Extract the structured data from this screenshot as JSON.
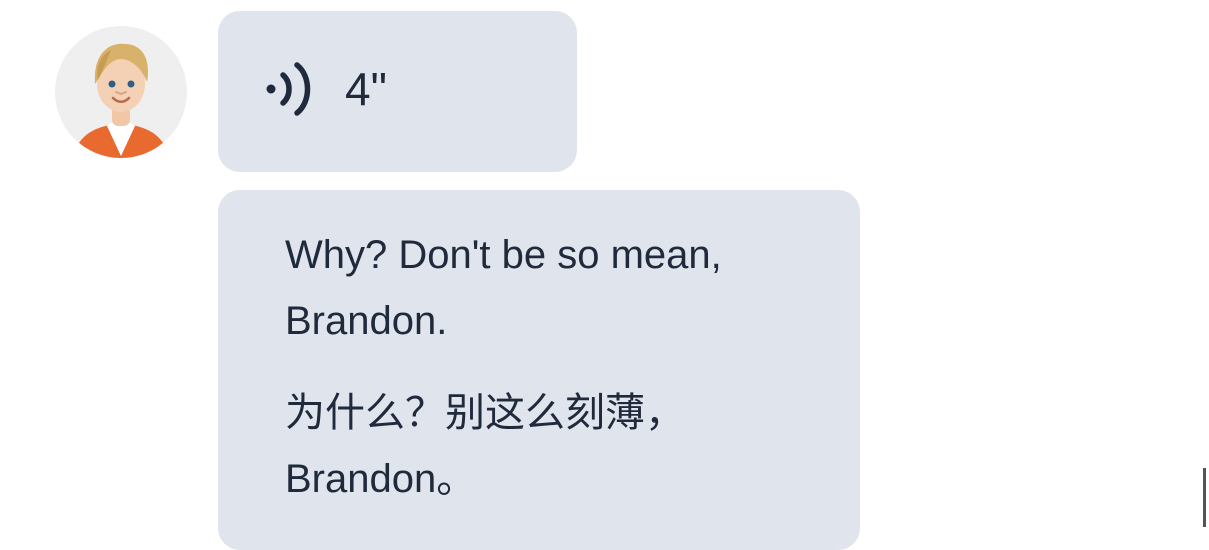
{
  "avatar": {
    "icon": "user-avatar-icon"
  },
  "voice_message": {
    "icon": "sound-wave-icon",
    "duration": "4\""
  },
  "text_message": {
    "english": "Why? Don't be so mean, Brandon.",
    "chinese": "为什么？别这么刻薄，Brandon。"
  },
  "colors": {
    "bubble_background": "#e0e4ec",
    "text": "#1f2a3c",
    "avatar_shirt": "#e86a2e",
    "avatar_hair": "#d8b26a"
  }
}
